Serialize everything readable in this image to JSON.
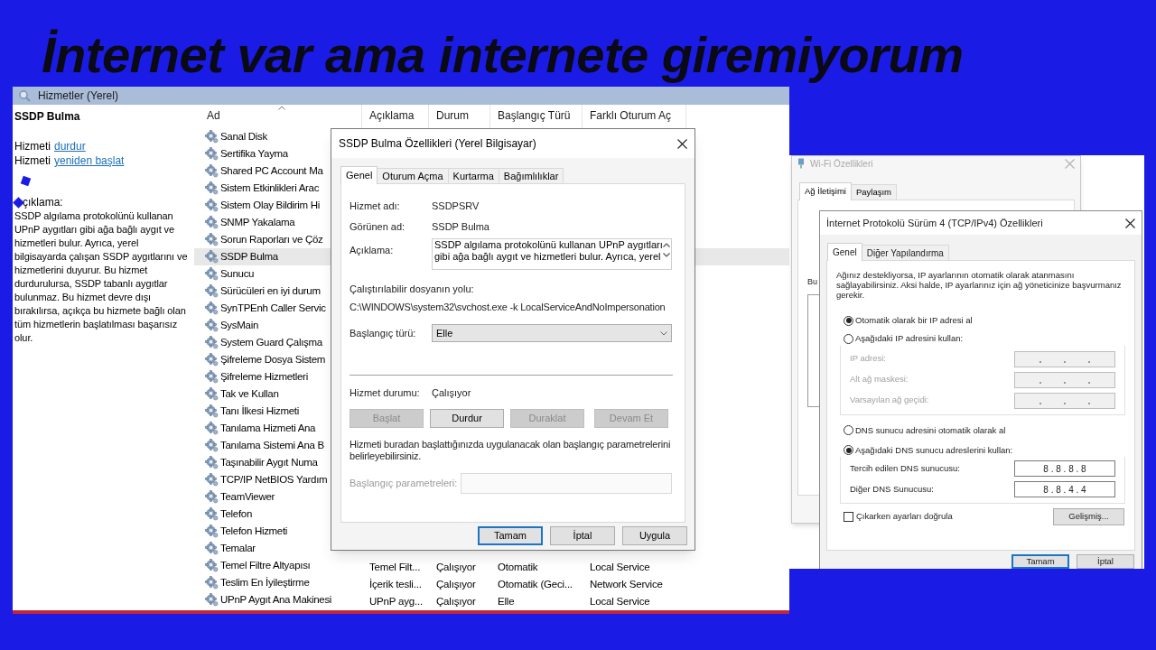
{
  "headline": "İnternet var ama internete giremiyorum",
  "services": {
    "title": "Hizmetler (Yerel)",
    "detail": {
      "name": "SSDP Bulma",
      "actions": [
        {
          "prefix": "Hizmeti",
          "link": "durdur"
        },
        {
          "prefix": "Hizmeti",
          "link": "yeniden başlat"
        }
      ],
      "description_label": "çıklama:",
      "description": "SSDP algılama protokolünü kullanan UPnP aygıtları gibi ağa bağlı aygıt ve hizmetleri bulur. Ayrıca, yerel bilgisayarda çalışan SSDP aygıtlarını ve hizmetlerini duyurur. Bu hizmet durdurulursa, SSDP tabanlı aygıtlar bulunmaz. Bu hizmet devre dışı bırakılırsa, açıkça bu hizmete bağlı olan tüm hizmetlerin başlatılması başarısız olur."
    },
    "columns": [
      {
        "label": "Ad",
        "sorted": true
      },
      {
        "label": "Açıklama",
        "sorted": false
      },
      {
        "label": "Durum",
        "sorted": false
      },
      {
        "label": "Başlangıç Türü",
        "sorted": false
      },
      {
        "label": "Farklı Oturum Aç",
        "sorted": false
      }
    ],
    "rows": [
      {
        "name": "Sanal Disk",
        "selected": false
      },
      {
        "name": "Sertifika Yayma",
        "selected": false
      },
      {
        "name": "Shared PC Account Ma",
        "selected": false
      },
      {
        "name": "Sistem Etkinlikleri Arac",
        "selected": false
      },
      {
        "name": "Sistem Olay Bildirim Hi",
        "selected": false
      },
      {
        "name": "SNMP Yakalama",
        "selected": false
      },
      {
        "name": "Sorun Raporları ve Çöz",
        "selected": false
      },
      {
        "name": "SSDP Bulma",
        "selected": true
      },
      {
        "name": "Sunucu",
        "selected": false
      },
      {
        "name": "Sürücüleri en iyi durum",
        "selected": false
      },
      {
        "name": "SynTPEnh Caller Servic",
        "selected": false
      },
      {
        "name": "SysMain",
        "selected": false
      },
      {
        "name": "System Guard Çalışma",
        "selected": false
      },
      {
        "name": "Şifreleme Dosya Sistem",
        "selected": false
      },
      {
        "name": "Şifreleme Hizmetleri",
        "selected": false
      },
      {
        "name": "Tak ve Kullan",
        "selected": false
      },
      {
        "name": "Tanı İlkesi Hizmeti",
        "selected": false
      },
      {
        "name": "Tanılama Hizmeti Ana",
        "selected": false
      },
      {
        "name": "Tanılama Sistemi Ana B",
        "selected": false
      },
      {
        "name": "Taşınabilir Aygıt Numa",
        "selected": false
      },
      {
        "name": "TCP/IP NetBIOS Yardım",
        "selected": false
      },
      {
        "name": "TeamViewer",
        "selected": false
      },
      {
        "name": "Telefon",
        "selected": false
      },
      {
        "name": "Telefon Hizmeti",
        "selected": false
      },
      {
        "name": "Temalar",
        "selected": false
      },
      {
        "name": "Temel Filtre Altyapısı",
        "selected": false,
        "cells": [
          "Temel Filt...",
          "Çalışıyor",
          "Otomatik",
          "Local Service"
        ]
      },
      {
        "name": "Teslim En İyileştirme",
        "selected": false,
        "cells": [
          "İçerik tesli...",
          "Çalışıyor",
          "Otomatik (Geci...",
          "Network Service"
        ]
      },
      {
        "name": "UPnP Aygıt Ana Makinesi",
        "selected": false,
        "cells": [
          "UPnP ayg...",
          "Çalışıyor",
          "Elle",
          "Local Service"
        ]
      }
    ]
  },
  "properties_dialog": {
    "title": "SSDP Bulma Özellikleri (Yerel Bilgisayar)",
    "tabs": [
      {
        "label": "Genel",
        "selected": true
      },
      {
        "label": "Oturum Açma",
        "selected": false
      },
      {
        "label": "Kurtarma",
        "selected": false
      },
      {
        "label": "Bağımlılıklar",
        "selected": false
      }
    ],
    "service_name": {
      "label": "Hizmet adı:",
      "value": "SSDPSRV"
    },
    "display_name": {
      "label": "Görünen ad:",
      "value": "SSDP Bulma"
    },
    "description": {
      "label": "Açıklama:",
      "lines": [
        "SSDP algılama protokolünü kullanan UPnP aygıtları",
        "gibi ağa bağlı aygıt ve hizmetleri bulur. Ayrıca, yerel"
      ]
    },
    "path": {
      "label": "Çalıştırılabilir dosyanın yolu:",
      "value": "C:\\WINDOWS\\system32\\svchost.exe -k LocalServiceAndNoImpersonation"
    },
    "startup_type": {
      "label": "Başlangıç türü:",
      "value": "Elle"
    },
    "status": {
      "label": "Hizmet durumu:",
      "value": "Çalışıyor"
    },
    "control_buttons": [
      {
        "label": "Başlat",
        "disabled": true
      },
      {
        "label": "Durdur",
        "disabled": false
      },
      {
        "label": "Duraklat",
        "disabled": true
      },
      {
        "label": "Devam Et",
        "disabled": true
      }
    ],
    "hint": "Hizmeti buradan başlattığınızda uygulanacak olan başlangıç parametrelerini belirleyebilirsiniz.",
    "parameters": {
      "label": "Başlangıç parametreleri:",
      "disabled": true
    },
    "buttons": [
      {
        "label": "Tamam",
        "default": true
      },
      {
        "label": "İptal",
        "default": false
      },
      {
        "label": "Uygula",
        "default": false
      }
    ]
  },
  "wifi_window": {
    "title": "Wi-Fi Özellikleri",
    "tabs": [
      {
        "label": "Ağ İletişimi",
        "selected": true
      },
      {
        "label": "Paylaşım",
        "selected": false
      }
    ],
    "list_label": "Bu"
  },
  "ipv4_dialog": {
    "title": "İnternet Protokolü Sürüm 4 (TCP/IPv4) Özellikleri",
    "tabs": [
      {
        "label": "Genel",
        "selected": true
      },
      {
        "label": "Diğer Yapılandırma",
        "selected": false
      }
    ],
    "intro": "Ağınız destekliyorsa, IP ayarlarının otomatik olarak atanmasını sağlayabilirsiniz. Aksi halde, IP ayarlarınız için ağ yöneticinize başvurmanız gerekir.",
    "ip_options": [
      {
        "label": "Otomatik olarak bir IP adresi al",
        "selected": true
      },
      {
        "label": "Aşağıdaki IP adresini kullan:",
        "selected": false
      }
    ],
    "ip_fields": [
      {
        "label": "IP adresi:",
        "disabled": true
      },
      {
        "label": "Alt ağ maskesi:",
        "disabled": true
      },
      {
        "label": "Varsayılan ağ geçidi:",
        "disabled": true
      }
    ],
    "dns_options": [
      {
        "label": "DNS sunucu adresini otomatik olarak al",
        "selected": false
      },
      {
        "label": "Aşağıdaki DNS sunucu adreslerini kullan:",
        "selected": true
      }
    ],
    "dns_fields": [
      {
        "label": "Tercih edilen DNS sunucusu:",
        "value": "8 . 8 . 8 . 8"
      },
      {
        "label": "Diğer DNS Sunucusu:",
        "value": "8 . 8 . 4 . 4"
      }
    ],
    "validate": {
      "label": "Çıkarken ayarları doğrula",
      "checked": false
    },
    "advanced_button": "Gelişmiş...",
    "buttons": [
      {
        "label": "Tamam",
        "default": true
      },
      {
        "label": "İptal",
        "default": false
      }
    ]
  }
}
